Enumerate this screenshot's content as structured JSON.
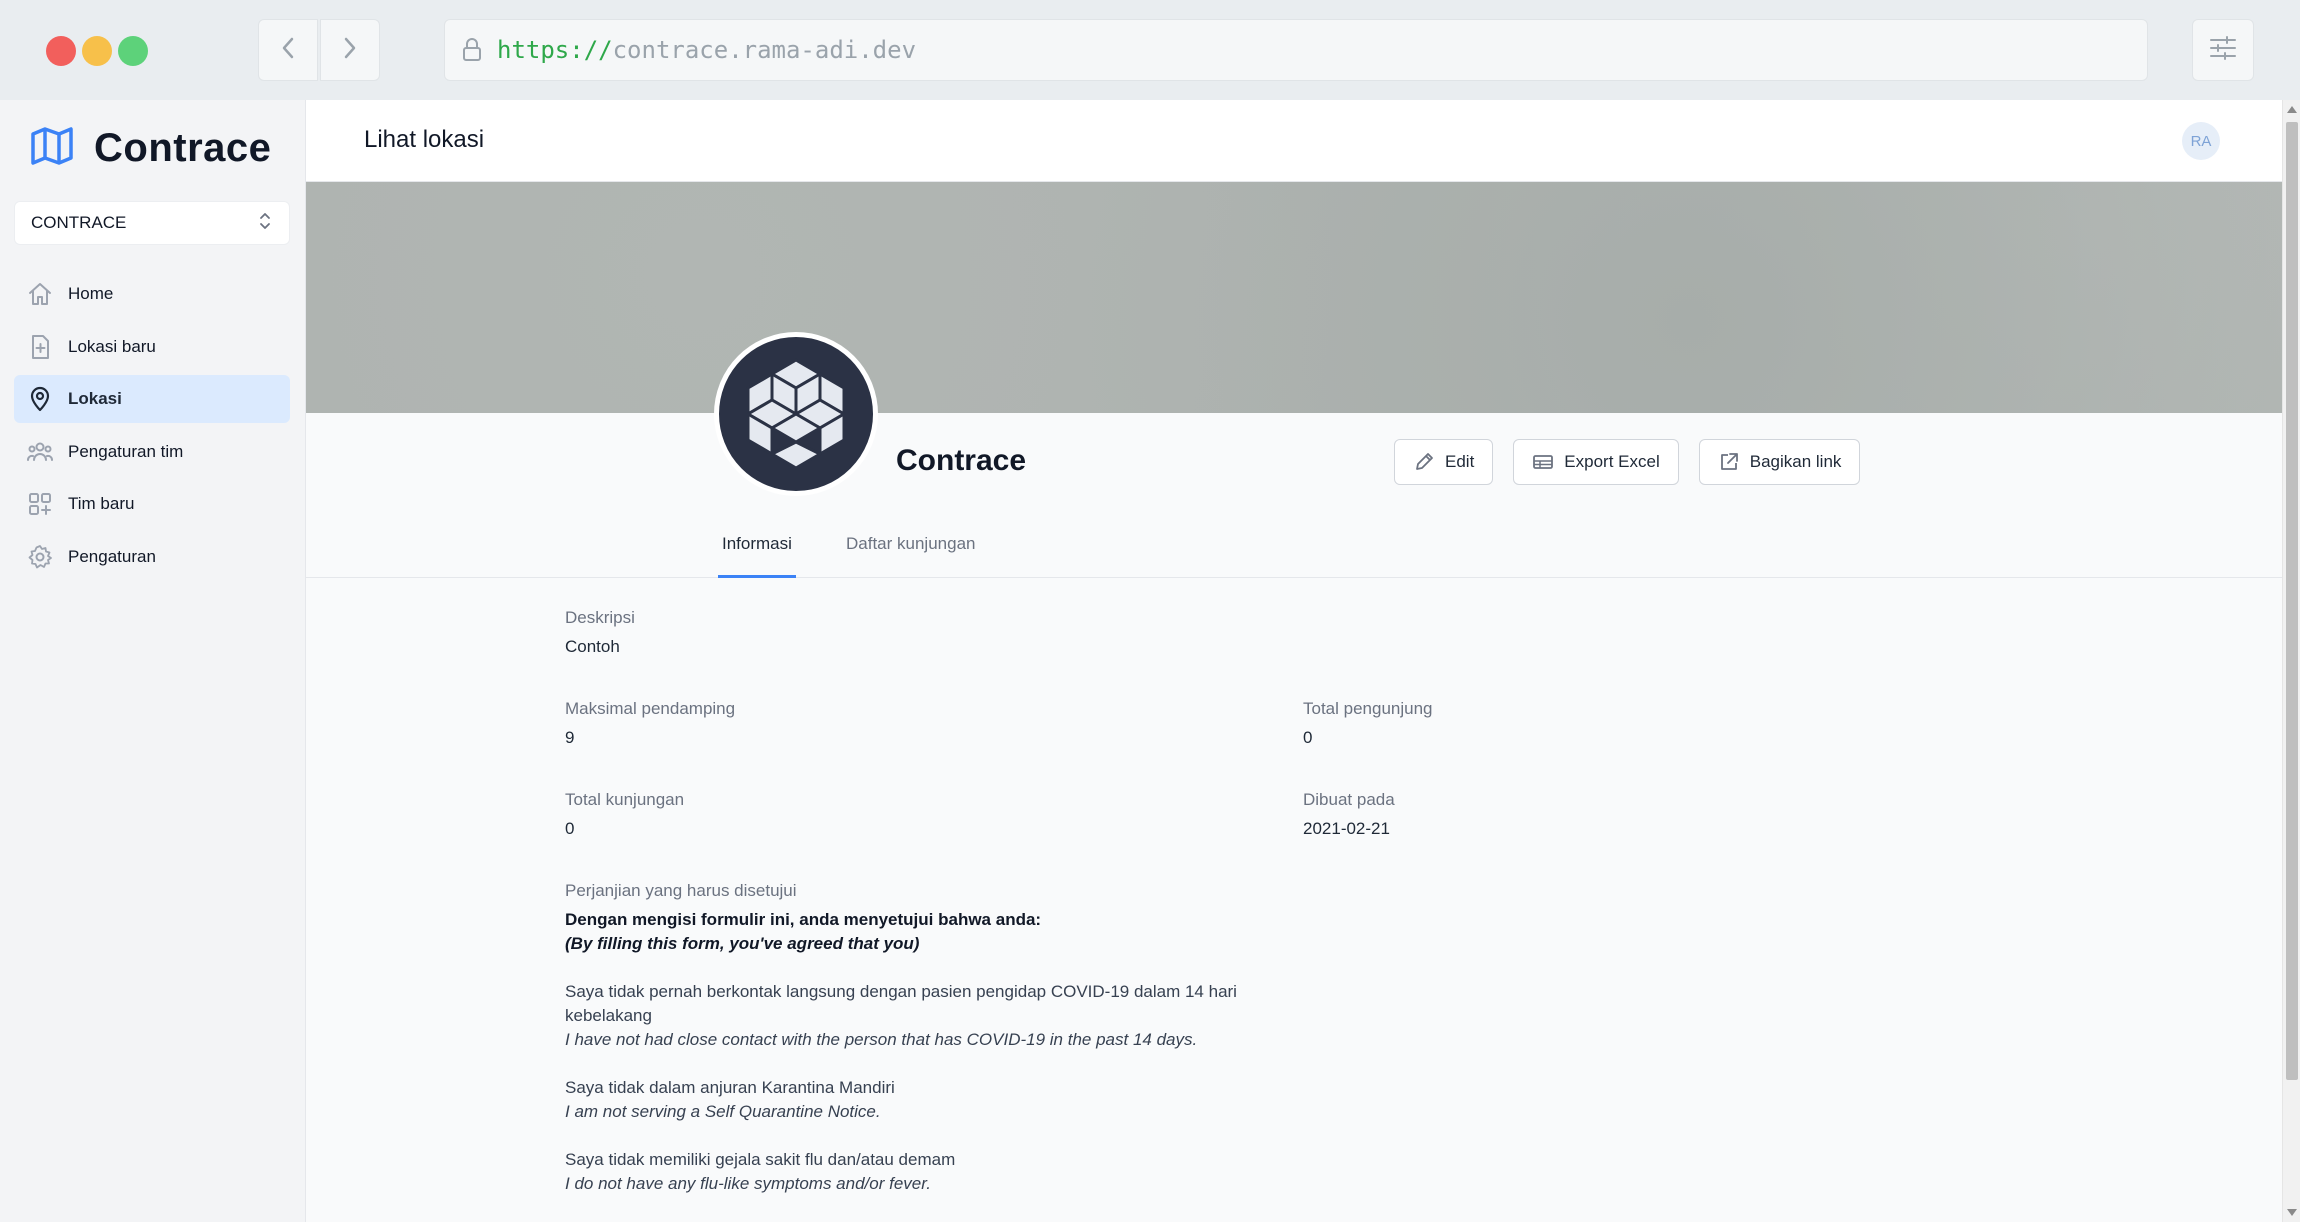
{
  "browser": {
    "url_scheme": "https://",
    "url_host": "contrace.rama-adi.dev"
  },
  "sidebar": {
    "brand": "Contrace",
    "team_selector": "CONTRACE",
    "items": [
      {
        "label": "Home",
        "icon": "home-icon",
        "active": false
      },
      {
        "label": "Lokasi baru",
        "icon": "file-plus-icon",
        "active": false
      },
      {
        "label": "Lokasi",
        "icon": "location-pin-icon",
        "active": true
      },
      {
        "label": "Pengaturan tim",
        "icon": "users-icon",
        "active": false
      },
      {
        "label": "Tim baru",
        "icon": "add-grid-icon",
        "active": false
      },
      {
        "label": "Pengaturan",
        "icon": "gear-icon",
        "active": false
      }
    ]
  },
  "header": {
    "title": "Lihat lokasi",
    "avatar_initials": "RA"
  },
  "location": {
    "name": "Contrace",
    "actions": {
      "edit": "Edit",
      "export": "Export Excel",
      "share": "Bagikan link"
    },
    "tabs": [
      "Informasi",
      "Daftar kunjungan"
    ],
    "fields": {
      "description_label": "Deskripsi",
      "description_value": "Contoh",
      "max_companion_label": "Maksimal pendamping",
      "max_companion_value": "9",
      "total_visitors_label": "Total pengunjung",
      "total_visitors_value": "0",
      "total_visits_label": "Total kunjungan",
      "total_visits_value": "0",
      "created_label": "Dibuat pada",
      "created_value": "2021-02-21"
    },
    "agreement": {
      "label": "Perjanjian yang harus disetujui",
      "intro_id": "Dengan mengisi formulir ini, anda menyetujui bahwa anda:",
      "intro_en": "(By filling this form, you've agreed that you)",
      "items": [
        {
          "id": "Saya tidak pernah berkontak langsung dengan pasien pengidap COVID-19 dalam 14 hari kebelakang",
          "en": "I have not had close contact with the person that has COVID-19 in the past 14 days."
        },
        {
          "id": "Saya tidak dalam anjuran Karantina Mandiri",
          "en": "I am not serving a Self Quarantine Notice."
        },
        {
          "id": "Saya tidak memiliki gejala sakit flu dan/atau demam",
          "en": "I do not have any flu-like symptoms and/or fever."
        }
      ]
    }
  },
  "colors": {
    "accent": "#3b82f6",
    "active_nav_bg": "#dbeafe",
    "logo_bg": "#2b3245"
  }
}
